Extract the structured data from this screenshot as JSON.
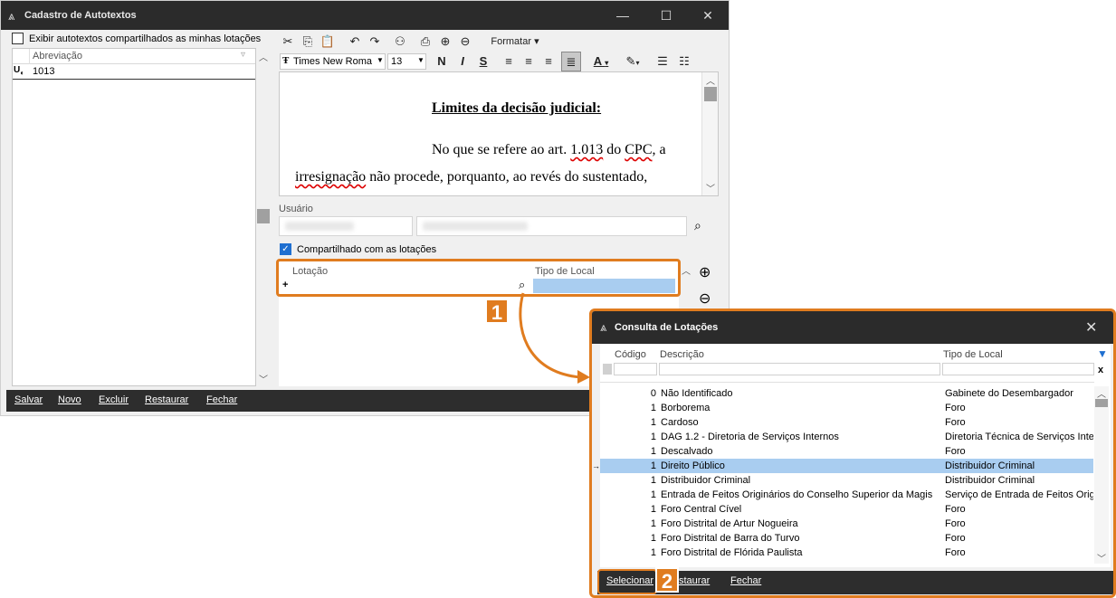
{
  "main": {
    "title": "Cadastro de Autotextos",
    "share_checkbox_label": "Exibir autotextos compartilhados as minhas lotações",
    "list_header": "Abreviação",
    "list_items": [
      "1013"
    ],
    "toolbar": {
      "format_menu": "Formatar",
      "font_name": "Times New Roma",
      "font_size": "13"
    },
    "editor": {
      "heading": "Limites da decisão judicial:",
      "para_line1": "No que se refere ao art. 1.013 do CPC, a",
      "para_line2": "irresignação não procede, porquanto, ao revés do sustentado,"
    },
    "user_label": "Usuário",
    "shared_checkbox_label": "Compartilhado com as lotações",
    "grid_headers": {
      "lotacao": "Lotação",
      "tipo": "Tipo de Local"
    },
    "grid_new_row_marker": "+",
    "bottom_buttons": [
      "Salvar",
      "Novo",
      "Excluir",
      "Restaurar",
      "Fechar"
    ]
  },
  "callouts": {
    "one": "1",
    "two": "2"
  },
  "dialog": {
    "title": "Consulta de Lotações",
    "headers": {
      "codigo": "Código",
      "descricao": "Descrição",
      "tipo": "Tipo de Local"
    },
    "rows": [
      {
        "codigo": "0",
        "descricao": "Não Identificado",
        "tipo": "Gabinete do Desembargador"
      },
      {
        "codigo": "1",
        "descricao": "Borborema",
        "tipo": "Foro"
      },
      {
        "codigo": "1",
        "descricao": "Cardoso",
        "tipo": "Foro"
      },
      {
        "codigo": "1",
        "descricao": "DAG 1.2 - Diretoria de Serviços Internos",
        "tipo": "Diretoria Técnica de Serviços Inte"
      },
      {
        "codigo": "1",
        "descricao": "Descalvado",
        "tipo": "Foro"
      },
      {
        "codigo": "1",
        "descricao": "Direito Público",
        "tipo": "Distribuidor Criminal"
      },
      {
        "codigo": "1",
        "descricao": "Distribuidor Criminal",
        "tipo": "Distribuidor Criminal"
      },
      {
        "codigo": "1",
        "descricao": "Entrada de Feitos Originários do Conselho Superior da Magis",
        "tipo": "Serviço de Entrada de Feitos Orig"
      },
      {
        "codigo": "1",
        "descricao": "Foro Central Cível",
        "tipo": "Foro"
      },
      {
        "codigo": "1",
        "descricao": "Foro Distrital de Artur Nogueira",
        "tipo": "Foro"
      },
      {
        "codigo": "1",
        "descricao": "Foro Distrital de Barra do Turvo",
        "tipo": "Foro"
      },
      {
        "codigo": "1",
        "descricao": "Foro Distrital de Flórida Paulista",
        "tipo": "Foro"
      }
    ],
    "selected_row": 5,
    "buttons": [
      "Selecionar",
      "Restaurar",
      "Fechar"
    ],
    "restaurar_visible": "staurar"
  },
  "colors": {
    "accent": "#e07c1f",
    "selection": "#a9cdf0",
    "checkbox": "#1f6fd0"
  }
}
